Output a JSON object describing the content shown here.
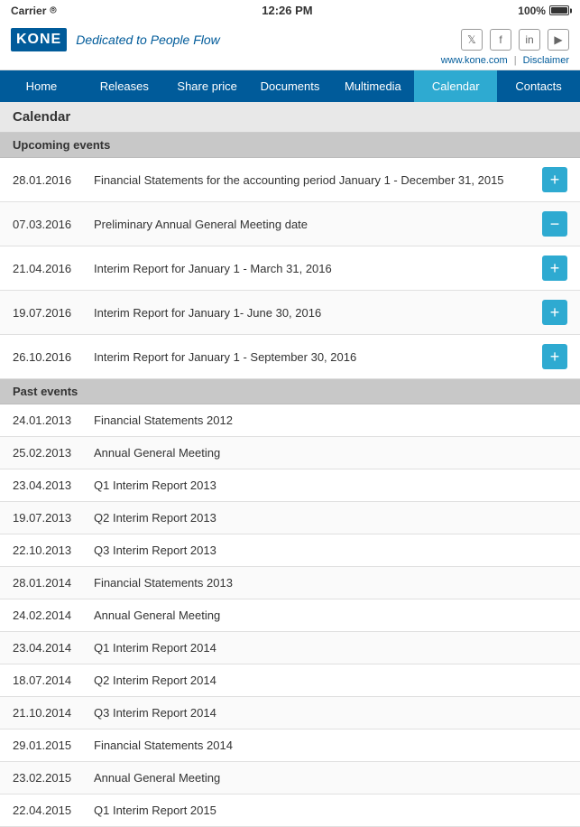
{
  "statusBar": {
    "carrier": "Carrier",
    "wifi": "wifi",
    "time": "12:26 PM",
    "battery": "100%"
  },
  "header": {
    "logo": "KONE",
    "tagline": "Dedicated to People Flow",
    "website": "www.kone.com",
    "disclaimer": "Disclaimer",
    "socialIcons": [
      "twitter",
      "facebook",
      "linkedin",
      "youtube"
    ]
  },
  "nav": {
    "items": [
      {
        "label": "Home",
        "active": false
      },
      {
        "label": "Releases",
        "active": false
      },
      {
        "label": "Share price",
        "active": false
      },
      {
        "label": "Documents",
        "active": false
      },
      {
        "label": "Multimedia",
        "active": false
      },
      {
        "label": "Calendar",
        "active": true
      },
      {
        "label": "Contacts",
        "active": false
      }
    ]
  },
  "pageTitle": "Calendar",
  "upcomingSection": "Upcoming events",
  "upcomingEvents": [
    {
      "date": "28.01.2016",
      "title": "Financial Statements for the accounting period January 1 - December 31, 2015",
      "action": "plus"
    },
    {
      "date": "07.03.2016",
      "title": "Preliminary Annual General Meeting date",
      "action": "minus"
    },
    {
      "date": "21.04.2016",
      "title": "Interim Report for January 1 - March 31, 2016",
      "action": "plus"
    },
    {
      "date": "19.07.2016",
      "title": "Interim Report for January 1- June 30, 2016",
      "action": "plus"
    },
    {
      "date": "26.10.2016",
      "title": "Interim Report for January 1 - September 30, 2016",
      "action": "plus"
    }
  ],
  "pastSection": "Past events",
  "pastEvents": [
    {
      "date": "24.01.2013",
      "title": "Financial Statements 2012"
    },
    {
      "date": "25.02.2013",
      "title": "Annual General Meeting"
    },
    {
      "date": "23.04.2013",
      "title": "Q1 Interim Report 2013"
    },
    {
      "date": "19.07.2013",
      "title": "Q2 Interim Report 2013"
    },
    {
      "date": "22.10.2013",
      "title": "Q3 Interim Report 2013"
    },
    {
      "date": "28.01.2014",
      "title": "Financial Statements 2013"
    },
    {
      "date": "24.02.2014",
      "title": "Annual General Meeting"
    },
    {
      "date": "23.04.2014",
      "title": "Q1 Interim Report 2014"
    },
    {
      "date": "18.07.2014",
      "title": "Q2 Interim Report 2014"
    },
    {
      "date": "21.10.2014",
      "title": "Q3 Interim Report 2014"
    },
    {
      "date": "29.01.2015",
      "title": "Financial Statements 2014"
    },
    {
      "date": "23.02.2015",
      "title": "Annual General Meeting"
    },
    {
      "date": "22.04.2015",
      "title": "Q1 Interim Report 2015"
    }
  ]
}
